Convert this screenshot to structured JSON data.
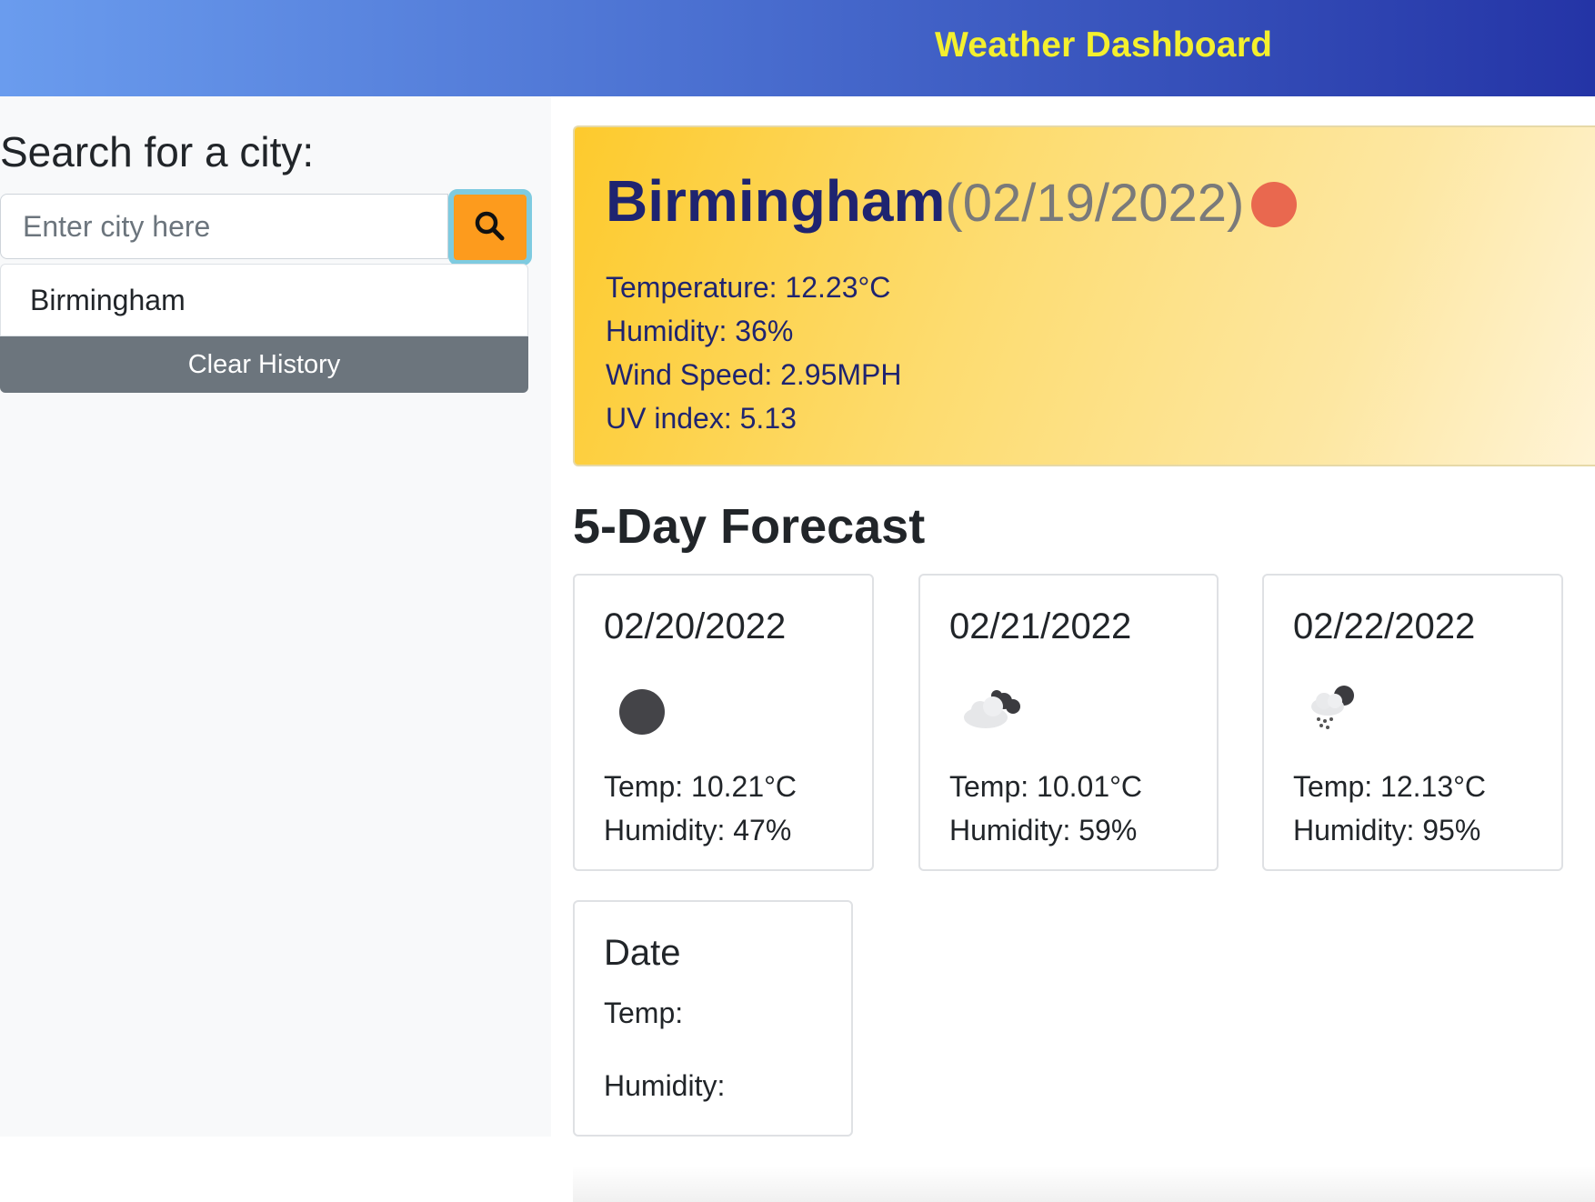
{
  "header": {
    "title": "Weather Dashboard"
  },
  "sidebar": {
    "heading": "Search for a city:",
    "search": {
      "placeholder": "Enter city here",
      "value": "",
      "button_icon": "search-icon"
    },
    "history": [
      "Birmingham"
    ],
    "clear_label": "Clear History"
  },
  "current": {
    "city": "Birmingham",
    "date": "(02/19/2022)",
    "icon": "sun-icon",
    "icon_color": "#e9684f",
    "temperature": "Temperature: 12.23°C",
    "humidity": "Humidity: 36%",
    "wind": "Wind Speed: 2.95MPH",
    "uv": "UV index: 5.13"
  },
  "forecast": {
    "heading": "5-Day Forecast",
    "days": [
      {
        "date": "02/20/2022",
        "icon": "moon-icon",
        "temp": "Temp: 10.21°C",
        "humidity": "Humidity: 47%"
      },
      {
        "date": "02/21/2022",
        "icon": "cloudy-night-icon",
        "temp": "Temp: 10.01°C",
        "humidity": "Humidity: 59%"
      },
      {
        "date": "02/22/2022",
        "icon": "rain-night-icon",
        "temp": "Temp: 12.13°C",
        "humidity": "Humidity: 95%"
      },
      {
        "date": "Date",
        "temp": "Temp:",
        "humidity": "Humidity:"
      }
    ]
  }
}
